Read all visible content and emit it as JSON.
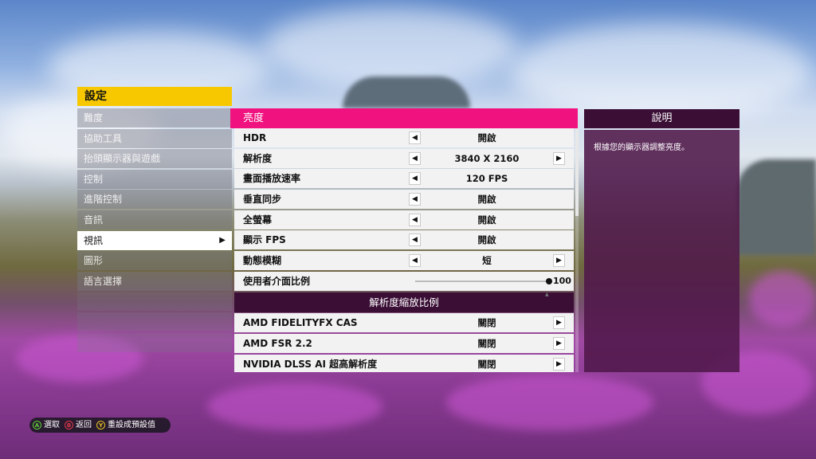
{
  "menu": {
    "title": "設定",
    "items": [
      {
        "label": "難度"
      },
      {
        "label": "協助工具"
      },
      {
        "label": "抬頭顯示器與遊戲"
      },
      {
        "label": "控制"
      },
      {
        "label": "進階控制"
      },
      {
        "label": "音訊"
      },
      {
        "label": "視訊",
        "selected": true,
        "arrow": "▶"
      },
      {
        "label": "圖形"
      },
      {
        "label": "語言選擇"
      }
    ]
  },
  "panel": {
    "header": "亮度",
    "rows": [
      {
        "label": "HDR",
        "value": "開啟",
        "left_arrow": true,
        "right_arrow": false
      },
      {
        "label": "解析度",
        "value": "3840 X 2160",
        "left_arrow": true,
        "right_arrow": true
      },
      {
        "label": "畫面播放速率",
        "value": "120 FPS",
        "left_arrow": true,
        "right_arrow": false
      },
      {
        "label": "垂直同步",
        "value": "開啟",
        "left_arrow": true,
        "right_arrow": false
      },
      {
        "label": "全螢幕",
        "value": "開啟",
        "left_arrow": true,
        "right_arrow": false
      },
      {
        "label": "顯示 FPS",
        "value": "開啟",
        "left_arrow": true,
        "right_arrow": false
      },
      {
        "label": "動態模糊",
        "value": "短",
        "left_arrow": true,
        "right_arrow": true
      }
    ],
    "slider": {
      "label": "使用者介面比例",
      "value": "100",
      "level": 100
    },
    "section_title": "解析度縮放比例",
    "scaling_rows": [
      {
        "label": "AMD FIDELITYFX CAS",
        "value": "關閉"
      },
      {
        "label": "AMD FSR 2.2",
        "value": "關閉"
      },
      {
        "label": "NVIDIA DLSS AI 超高解析度",
        "value": "關閉"
      }
    ],
    "arrow_left": "◀",
    "arrow_right": "▶"
  },
  "help": {
    "title": "說明",
    "text": "根據您的顯示器調整亮度。"
  },
  "prompts": [
    {
      "button": "A",
      "label": "選取",
      "color": "#5fcf3a"
    },
    {
      "button": "B",
      "label": "返回",
      "color": "#e0394b"
    },
    {
      "button": "Y",
      "label": "重設成預設值",
      "color": "#e9c41f"
    }
  ]
}
